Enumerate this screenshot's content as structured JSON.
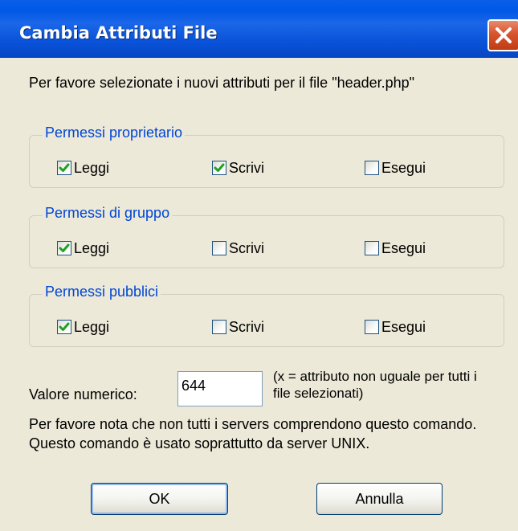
{
  "window": {
    "title": "Cambia Attributi File"
  },
  "prompt": "Per favore selezionate i nuovi attributi per il file \"header.php\"",
  "groups": [
    {
      "legend": "Permessi proprietario",
      "items": [
        {
          "label": "Leggi",
          "checked": true
        },
        {
          "label": "Scrivi",
          "checked": true
        },
        {
          "label": "Esegui",
          "checked": false
        }
      ]
    },
    {
      "legend": "Permessi di gruppo",
      "items": [
        {
          "label": "Leggi",
          "checked": true
        },
        {
          "label": "Scrivi",
          "checked": false
        },
        {
          "label": "Esegui",
          "checked": false
        }
      ]
    },
    {
      "legend": "Permessi pubblici",
      "items": [
        {
          "label": "Leggi",
          "checked": true
        },
        {
          "label": "Scrivi",
          "checked": false
        },
        {
          "label": "Esegui",
          "checked": false
        }
      ]
    }
  ],
  "numeric": {
    "label": "Valore numerico:",
    "value": "644",
    "note": "(x = attributo non uguale per tutti i file selezionati)"
  },
  "warning": "Per favore nota che non tutti i servers comprendono questo comando. Questo comando è usato soprattutto da server UNIX.",
  "buttons": {
    "ok": "OK",
    "cancel": "Annulla"
  },
  "icons": {
    "close": "close-icon",
    "check": "checkmark-icon"
  },
  "colors": {
    "titlebar": "#0058e6",
    "legend_text": "#0046d5",
    "close_button": "#d6542e",
    "checkmark": "#21a121",
    "dialog_background": "#ece9d8"
  }
}
